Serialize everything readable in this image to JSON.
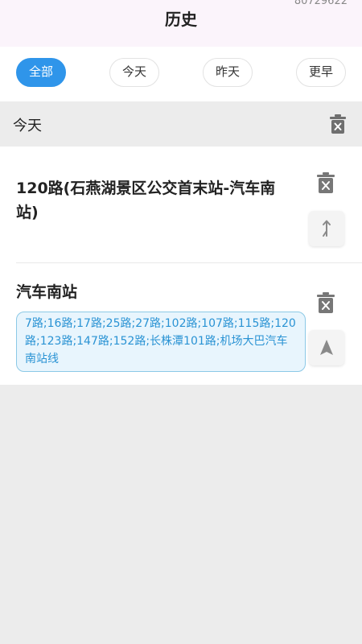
{
  "header": {
    "title": "历史",
    "code": "80729622"
  },
  "filters": [
    {
      "label": "全部",
      "active": true
    },
    {
      "label": "今天",
      "active": false
    },
    {
      "label": "昨天",
      "active": false
    },
    {
      "label": "更早",
      "active": false
    }
  ],
  "section": {
    "title": "今天"
  },
  "items": [
    {
      "title": "120路(石燕湖景区公交首末站-汽车南站)",
      "icons": [
        "delete-icon",
        "route-direction-icon"
      ]
    },
    {
      "title": "汽车南站",
      "routes": "7路;16路;17路;25路;27路;102路;107路;115路;120路;123路;147路;152路;长株潭101路;机场大巴汽车南站线",
      "icons": [
        "delete-icon",
        "navigate-arrow-icon"
      ]
    }
  ],
  "colors": {
    "accent": "#2f95ea",
    "header_bg": "#fbf4fb",
    "route_text": "#2a93d4",
    "route_bg": "#e8f5fd"
  }
}
